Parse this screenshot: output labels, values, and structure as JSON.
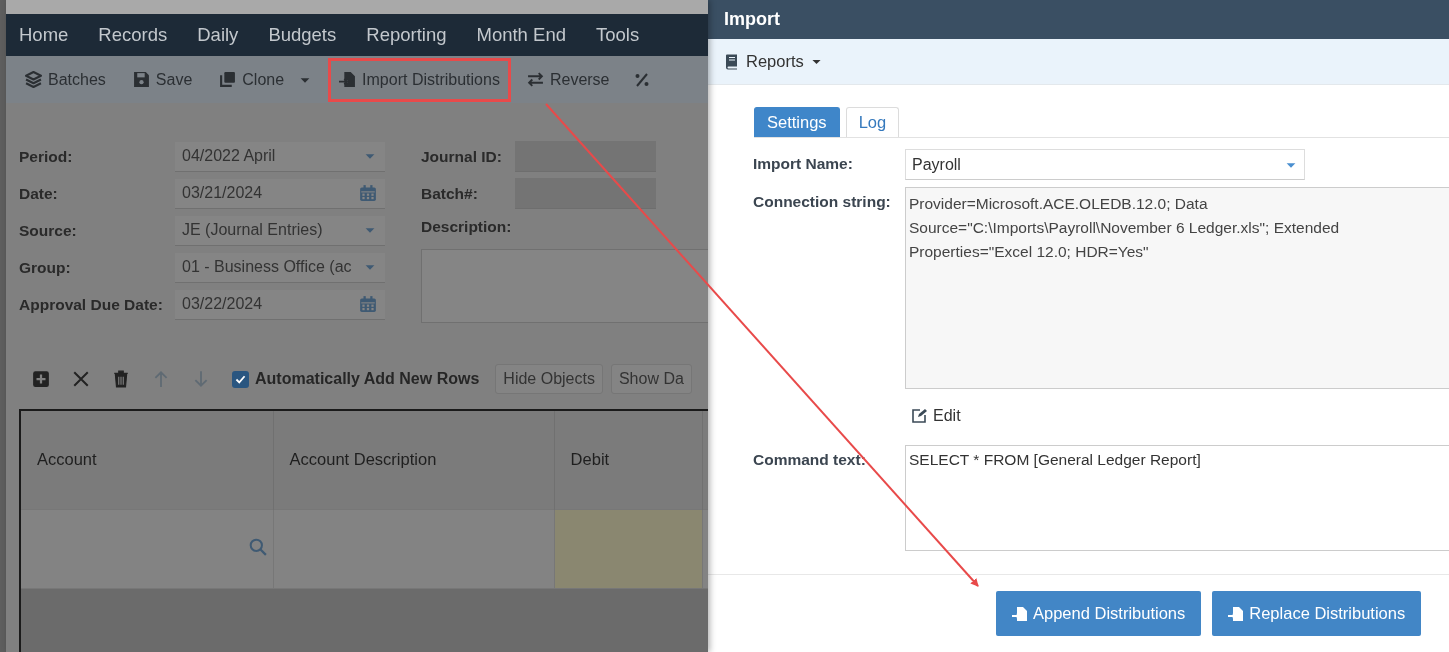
{
  "app": {
    "nav": [
      {
        "label": "Home"
      },
      {
        "label": "Records"
      },
      {
        "label": "Daily"
      },
      {
        "label": "Budgets"
      },
      {
        "label": "Reporting"
      },
      {
        "label": "Month End"
      },
      {
        "label": "Tools"
      }
    ],
    "toolbar": [
      {
        "label": "Batches",
        "kind": "button",
        "highlighted": false
      },
      {
        "label": "Save",
        "kind": "button",
        "highlighted": false
      },
      {
        "label": "Clone",
        "kind": "dropdown",
        "highlighted": false
      },
      {
        "label": "Import Distributions",
        "kind": "button",
        "highlighted": true
      },
      {
        "label": "Reverse",
        "kind": "button",
        "highlighted": false
      }
    ],
    "fields_left": [
      {
        "label": "Period:",
        "value": "04/2022  April",
        "kind": "dropdown"
      },
      {
        "label": "Date:",
        "value": "03/21/2024",
        "kind": "date"
      },
      {
        "label": "Source:",
        "value": "JE (Journal Entries)",
        "kind": "dropdown"
      },
      {
        "label": "Group:",
        "value": "01 - Business Office (ac",
        "kind": "dropdown"
      },
      {
        "label": "Approval Due Date:",
        "value": "03/22/2024",
        "kind": "date"
      }
    ],
    "fields_right": [
      {
        "label": "Journal ID:",
        "kind": "readonly"
      },
      {
        "label": "Batch#:",
        "kind": "readonly"
      },
      {
        "label": "Description:",
        "kind": "textarea"
      }
    ],
    "grid_toolbar": {
      "auto_add": {
        "label": "Automatically Add New Rows",
        "checked": true
      },
      "buttons": [
        "Hide Objects",
        "Show Da"
      ]
    },
    "table": {
      "columns": [
        "Account",
        "Account Description",
        "Debit"
      ]
    }
  },
  "dialog": {
    "title": "Import",
    "menu": {
      "label": "Reports"
    },
    "tabs": [
      {
        "label": "Settings",
        "selected": true
      },
      {
        "label": "Log",
        "selected": false
      }
    ],
    "import_name": {
      "label": "Import Name:",
      "value": "Payroll"
    },
    "connection_string": {
      "label": "Connection string:",
      "value": "Provider=Microsoft.ACE.OLEDB.12.0; Data Source=\"C:\\Imports\\Payroll\\November 6 Ledger.xls\"; Extended Properties=\"Excel 12.0; HDR=Yes\""
    },
    "edit_link": "Edit",
    "command_text": {
      "label": "Command text:",
      "value": "SELECT * FROM [General Ledger Report]"
    },
    "buttons": [
      "Append Distributions",
      "Replace Distributions"
    ]
  }
}
